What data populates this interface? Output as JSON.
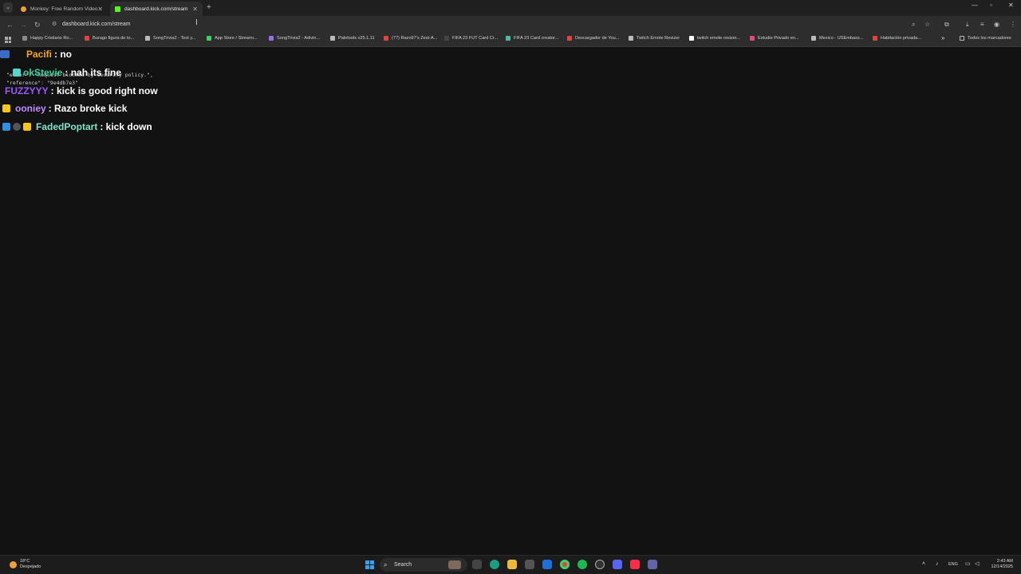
{
  "browser": {
    "tabs": [
      {
        "title": "Monkey: Free Random Video C",
        "color": "#f0a03a",
        "active": false
      },
      {
        "title": "dashboard.kick.com/stream",
        "color": "#53fc18",
        "active": true
      }
    ],
    "url": "dashboard.kick.com/stream",
    "bookmarks": [
      {
        "label": "Happy Cristiano Ro...",
        "color": "#888888"
      },
      {
        "label": "Burago figura de to...",
        "color": "#e0443e"
      },
      {
        "label": "SongTrivia2 - Test y...",
        "color": "#bbbbbb"
      },
      {
        "label": "App Store / Streami...",
        "color": "#3ad16b"
      },
      {
        "label": "SongTrivia2 - Adivin...",
        "color": "#9b6cf0"
      },
      {
        "label": "Paletools v25.1.11",
        "color": "#bbbbbb"
      },
      {
        "label": "(77) Razo97's Zest-A...",
        "color": "#e0443e"
      },
      {
        "label": "FIFA 23 FUT Card Cr...",
        "color": "#444444"
      },
      {
        "label": "FIFA 23 Card creator...",
        "color": "#49c0a6"
      },
      {
        "label": "Descargador de You...",
        "color": "#e0443e"
      },
      {
        "label": "Twitch Emote Resizer",
        "color": "#bbbbbb"
      },
      {
        "label": "twitch emote resizer...",
        "color": "#ffffff"
      },
      {
        "label": "Estudio Privado en...",
        "color": "#e04a78"
      },
      {
        "label": "Mexico - USEmbass...",
        "color": "#bbbbbb"
      },
      {
        "label": "Habitación privada...",
        "color": "#e0443e"
      }
    ],
    "all_bookmarks": "Todos los marcadores"
  },
  "chat": {
    "messages": [
      {
        "user": "Pacifi",
        "text": ": no",
        "user_color": "#f5a623"
      },
      {
        "user": "okStevie",
        "text": ": nah its fine",
        "user_color": "#3ad1a0"
      },
      {
        "user": "FUZZYYY",
        "text": ": kick is good right now",
        "user_color": "#9b59ff"
      },
      {
        "user": "ooniey",
        "text": ": Razo broke kick",
        "user_color": "#c08cff"
      },
      {
        "user": "FadedPoptart",
        "text": ": kick down",
        "user_color": "#7fe3c7"
      }
    ],
    "overlay_lines": [
      "\"error\": \"Request blocked by security policy.\",",
      "\"reference\": \"9e4db7e3\""
    ],
    "overlay_top": "\"reque..."
  },
  "taskbar": {
    "weather_temp": "18°C",
    "weather_desc": "Despejado",
    "search_label": "Search",
    "lang": "ENG",
    "time": "2:43 AM",
    "date": "12/14/2025"
  }
}
